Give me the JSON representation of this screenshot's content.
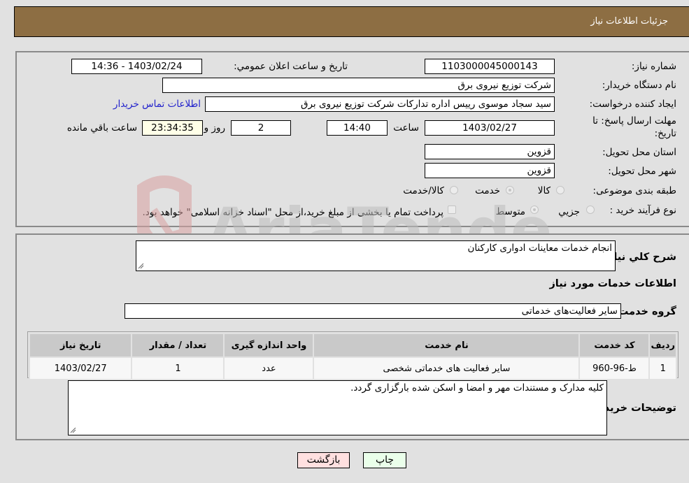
{
  "header": {
    "title": "جزئيات اطلاعات نياز"
  },
  "form": {
    "need_number_label": "شماره نياز:",
    "need_number": "1103000045000143",
    "announce_label": "تاريخ و ساعت اعلان عمومي:",
    "announce_value": "1403/02/24 - 14:36",
    "buyer_org_label": "نام دستگاه خريدار:",
    "buyer_org": "شرکت توزيع نيروی برق",
    "creator_label": "ايجاد کننده درخواست:",
    "creator": "سيد سجاد موسوی رييس اداره تدارکات شرکت توزيع نيروی برق",
    "contact_link": "اطلاعات تماس خريدار",
    "deadline_label_1": "مهلت ارسال پاسخ: تا",
    "deadline_label_2": "تاريخ:",
    "deadline_date": "1403/02/27",
    "time_label": "ساعت",
    "deadline_time": "14:40",
    "days_remaining": "2",
    "days_label": "روز و",
    "time_remaining": "23:34:35",
    "time_remaining_label": "ساعت باقي مانده",
    "province_label": "استان محل تحويل:",
    "province": "قزوين",
    "city_label": "شهر محل تحويل:",
    "city": "قزوين",
    "category_label": "طبقه بندی موضوعی:",
    "category_options": [
      "کالا",
      "خدمت",
      "کالا/خدمت"
    ],
    "category_selected": "خدمت",
    "process_label": "نوع فرآيند خريد :",
    "process_options": [
      "جزيي",
      "متوسط"
    ],
    "process_selected": "متوسط",
    "treasury_note": "پرداخت تمام يا بخشی از مبلغ خريد،از محل \"اسناد خزانه اسلامی\" خواهد بود.",
    "treasury_checked": false
  },
  "details": {
    "description_label": "شرح كلي نياز:",
    "description": "انجام  خدمات معاينات ادواری کارکنان",
    "services_heading": "اطلاعات خدمات مورد نياز",
    "service_group_label": "گروه خدمت:",
    "service_group": "ساير فعاليت‌های خدماتی",
    "table": {
      "headers": [
        "رديف",
        "كد خدمت",
        "نام خدمت",
        "واحد اندازه گيری",
        "تعداد / مقدار",
        "تاريخ نياز"
      ],
      "rows": [
        [
          "1",
          "ط-96-960",
          "ساير فعاليت های خدماتی شخصی",
          "عدد",
          "1",
          "1403/02/27"
        ]
      ]
    },
    "buyer_notes_label": "توضيحات خريدار:",
    "buyer_notes": "كليه مدارک و مستندات مهر و امضا و اسکن شده بارگزاری گردد."
  },
  "buttons": {
    "print": "چاپ",
    "back": "بازگشت"
  },
  "watermark": {
    "text": "AriaTender.net"
  }
}
